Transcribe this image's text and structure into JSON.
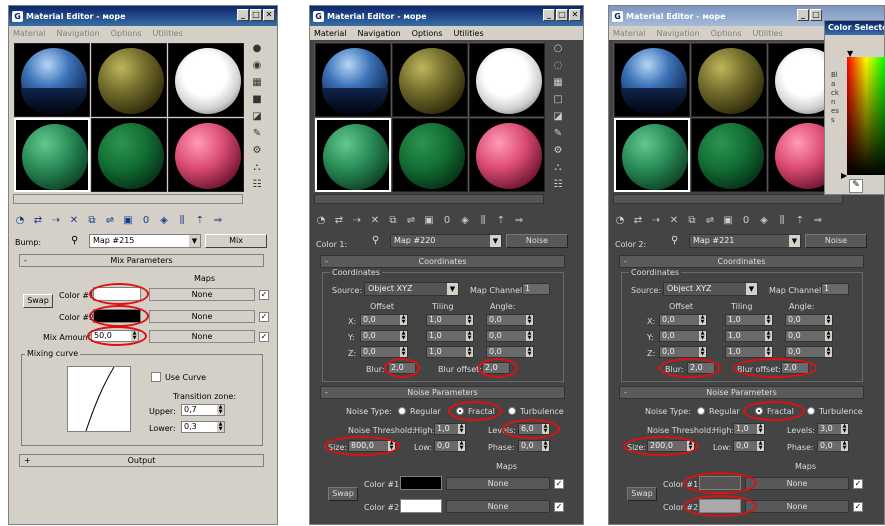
{
  "left": {
    "title": "Material Editor - море",
    "menu": [
      "Material",
      "Navigation",
      "Options",
      "Utilities"
    ],
    "bump_label": "Bump:",
    "map_name": "Map #215",
    "map_type": "Mix",
    "rollout_mix": "Mix Parameters",
    "maps_header": "Maps",
    "swap": "Swap",
    "color1_label": "Color #1",
    "color2_label": "Color #2",
    "mix_amount_label": "Mix Amount:",
    "mix_amount_value": "50,0",
    "none1": "None",
    "none2": "None",
    "none3": "None",
    "mixing_curve": "Mixing curve",
    "use_curve": "Use Curve",
    "transition_zone": "Transition zone:",
    "upper_label": "Upper:",
    "upper_value": "0,7",
    "lower_label": "Lower:",
    "lower_value": "0,3",
    "rollout_output": "Output",
    "plus": "+",
    "minus": "-"
  },
  "mid": {
    "title": "Material Editor - море",
    "menu": [
      "Material",
      "Navigation",
      "Options",
      "Utilities"
    ],
    "color_label": "Color 1:",
    "map_name": "Map #220",
    "map_type": "Noise",
    "rollout_coord": "Coordinates",
    "coord_group": "Coordinates",
    "source_label": "Source:",
    "source_value": "Object XYZ",
    "map_channel_label": "Map Channel:",
    "map_channel_value": "1",
    "offset": "Offset",
    "tiling": "Tiling",
    "angle": "Angle:",
    "x": "X:",
    "y": "Y:",
    "z": "Z:",
    "zero": "0,0",
    "one": "1,0",
    "blur_label": "Blur:",
    "blur_value": "2,0",
    "blur_offset_label": "Blur offset:",
    "blur_offset_value": "2,0",
    "rollout_noise": "Noise Parameters",
    "noise_type": "Noise Type:",
    "regular": "Regular",
    "fractal": "Fractal",
    "turbulence": "Turbulence",
    "noise_threshold": "Noise Threshold:",
    "high_label": "High:",
    "high_value": "1,0",
    "levels_label": "Levels:",
    "levels_value": "6,0",
    "size_label": "Size:",
    "size_value": "800,0",
    "low_label": "Low:",
    "low_value": "0,0",
    "phase_label": "Phase:",
    "phase_value": "0,0",
    "maps_header": "Maps",
    "swap": "Swap",
    "color1": "Color #1",
    "color2": "Color #2",
    "none": "None",
    "minus": "-"
  },
  "right": {
    "title": "Material Editor - море",
    "menu": [
      "Material",
      "Navigation",
      "Options",
      "Utilities"
    ],
    "color_label": "Color 2:",
    "map_name": "Map #221",
    "map_type": "Noise",
    "rollout_coord": "Coordinates",
    "coord_group": "Coordinates",
    "source_label": "Source:",
    "source_value": "Object XYZ",
    "map_channel_label": "Map Channel:",
    "map_channel_value": "1",
    "offset": "Offset",
    "tiling": "Tiling",
    "angle": "Angle:",
    "x": "X:",
    "y": "Y:",
    "z": "Z:",
    "zero": "0,0",
    "one": "1,0",
    "blur_label": "Blur:",
    "blur_value": "2,0",
    "blur_offset_label": "Blur offset:",
    "blur_offset_value": "2,0",
    "rollout_noise": "Noise Parameters",
    "noise_type": "Noise Type:",
    "regular": "Regular",
    "fractal": "Fractal",
    "turbulence": "Turbulence",
    "noise_threshold": "Noise Threshold:",
    "high_label": "High:",
    "high_value": "1,0",
    "levels_label": "Levels:",
    "levels_value": "3,0",
    "size_label": "Size:",
    "size_value": "200,0",
    "low_label": "Low:",
    "low_value": "0,0",
    "phase_label": "Phase:",
    "phase_value": "0,0",
    "maps_header": "Maps",
    "swap": "Swap",
    "color1": "Color #1",
    "color2": "Color #2",
    "none": "None",
    "minus": "-"
  },
  "color_selector": {
    "title": "Color Selector",
    "blackness": "Blackness"
  },
  "colors": {
    "highlight": "#e01010",
    "color_black": "#000000",
    "color_white": "#ffffff",
    "color_dgray": "#555555",
    "color_lgray": "#aaaaaa"
  }
}
